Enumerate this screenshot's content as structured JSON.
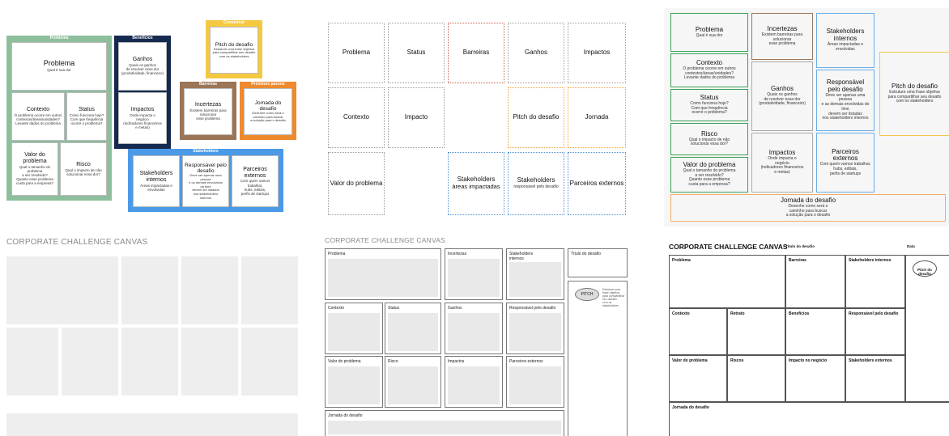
{
  "colors": {
    "green": "#8dbf9c",
    "navy": "#162a4f",
    "yellow": "#f5c842",
    "brown": "#9b7556",
    "orange": "#ee8a2d",
    "blue": "#4a9ae8",
    "p3_green": "#3aa056",
    "p3_blue": "#6aaee6",
    "p3_orange": "#f2ac6a",
    "p3_yellow": "#f2c84b",
    "dot_red": "#c45b4a",
    "dot_orange": "#f0a240",
    "dot_blue": "#4f8fd0"
  },
  "panel1": {
    "groups": {
      "problema": "Problema",
      "beneficios": "Benefícios",
      "comunicar": "Comunicar",
      "barreiras": "Barreiras",
      "proximos": "Próximos passos",
      "stakeholders": "Stakeholders"
    },
    "problema": {
      "t": "Problema",
      "s": "Qual é sua dor"
    },
    "contexto": {
      "t": "Contexto",
      "s": "O problema ocorre em outros\ncontextos/áreas/unidades?\nLevante dados do problema"
    },
    "status": {
      "t": "Status",
      "s": "Como funciona hoje?\nCom que frequência\nocorre o problema?"
    },
    "valor": {
      "t": "Valor do problema",
      "s": "Qual o tamanho do problema\na ser resolvido?\nQuanto esse problema\ncusta para a empresa?"
    },
    "risco": {
      "t": "Risco",
      "s": "Qual o impacto de não\nsolucionar essa dor?"
    },
    "ganhos": {
      "t": "Ganhos",
      "s": "Quais os ganhos\nde resolver essa dor\n(produtividade, financeiro)"
    },
    "impactos": {
      "t": "Impactos",
      "s": "Onde impacta o\nnegócio\n(indicadores financeiros\ne metas)"
    },
    "pitch": {
      "t": "Pitch do desafio",
      "s": "Estruture uma frase objetiva\npara compartilhar seu desafio\ncom os stakeholders"
    },
    "incertezas": {
      "t": "Incertezas",
      "s": "Existem barreiras para\nsolucionar\nesse problema"
    },
    "jornada": {
      "t": "Jornada do desafio",
      "s": "Desenhe como será o\ncaminho para buscar\na solução para o desafio"
    },
    "stake_int": {
      "t": "Stakeholders internos",
      "s": "Áreas impactadas e\nenvolvidas"
    },
    "responsavel": {
      "t": "Responsável pelo desafio",
      "s": "Deve ser apenas uma\npessoa\ne os demais envolvidos\nda time\ndevem ser listados\nnos stakeholders\ninternos"
    },
    "parceiros": {
      "t": "Parceiros externos",
      "s": "Com quem vamos\ntrabalhar,\nhubs, editais,\nperfis de startups"
    }
  },
  "panel2": {
    "problema": "Problema",
    "status": "Status",
    "barreiras": "Barreiras",
    "ganhos": "Ganhos",
    "impactos": "Impactos",
    "contexto": "Contexto",
    "impacto": "Impacto",
    "pitch": "Pitch do desafio",
    "jornada": "Jornada",
    "valor": "Valor do problema",
    "stake_areas_t": "Stakeholders",
    "stake_areas_s": "áreas impactadas",
    "stake_resp_t": "Stakeholders",
    "stake_resp_s": "responsável pelo desafio",
    "parceiros": "Parceiros externos"
  },
  "panel3": {
    "problema": {
      "t": "Problema",
      "s": "Qual é sua dor"
    },
    "contexto": {
      "t": "Contexto",
      "s": "O problema ocorre em outros\ncontextos/áreas/unidades?\nLevante dados do problema"
    },
    "status": {
      "t": "Status",
      "s": "Como funciona hoje?\nCom que frequência\nocorre o problema?"
    },
    "risco": {
      "t": "Risco",
      "s": "Qual o impacto de não\nsolucionar essa dor?"
    },
    "valor": {
      "t": "Valor do problema",
      "s": "Qual o tamanho do problema\na ser resolvido?\nQuanto esse problema\ncusta para a empresa?"
    },
    "incertezas": {
      "t": "Incertezas",
      "s": "Existem barreiras para\nsolucionar\nesse problema"
    },
    "ganhos": {
      "t": "Ganhos",
      "s": "Quais os ganhos\nde resolver essa dor\n(produtividade, financeiro)"
    },
    "impactos": {
      "t": "Impactos",
      "s": "Onde impacta o\nnegócio\n(indicadores financeiros\ne metas)"
    },
    "stake_int": {
      "t": "Stakeholders\ninternos",
      "s": "Áreas impactadas e envolvidas"
    },
    "responsavel": {
      "t": "Responsável\npelo desafio",
      "s": "Deve ser apenas uma pessoa\ne as demais envolvidas do time\ndevem ser listadas\nnos stakeholders internos"
    },
    "parceiros": {
      "t": "Parceiros externos",
      "s": "Com quem vamos trabalhar,\nhubs, editais,\nperfis de startups"
    },
    "pitch": {
      "t": "Pitch do desafio",
      "s": "Estruture uma frase objetiva\npara compartilhar seu desafio\ncom os stakeholders"
    },
    "jornada": {
      "t": "Jornada do desafio",
      "s": "Desenhe como será o\ncaminho para buscar\na solução para o desafio"
    }
  },
  "panel4": {
    "title": "CORPORATE CHALLENGE CANVAS"
  },
  "panel5": {
    "title": "CORPORATE CHALLENGE CANVAS",
    "problema": "Problema",
    "incertezas": "Incertezas",
    "stake_int": "Stakeholders\ninternos",
    "titulo": "Título do desafio",
    "contexto": "Contexto",
    "status": "Status",
    "ganhos": "Ganhos",
    "responsavel": "Responsável pelo desafio",
    "pitch": "PITCH",
    "pitch_note": "Estruture uma\nfrase objetiva\npara compartilhar\nseu desafio\ncom os\nstakeholders",
    "valor": "Valor do problema",
    "risco": "Risco",
    "impactos": "Impactos",
    "parceiros": "Parceiros externos",
    "jornada": "Jornada do desafio"
  },
  "panel6": {
    "title": "CORPORATE CHALLENGE CANVAS",
    "titulo": "Título do desafio",
    "data": "Data",
    "problema": "Problema",
    "barreiras": "Barreiras",
    "stake_int": "Stakeholders internos",
    "contexto": "Contexto",
    "retrato": "Retrato",
    "beneficios": "Benefícios",
    "responsavel": "Responsável pelo desafio",
    "valor": "Valor do problema",
    "riscos": "Riscos",
    "impacto": "Impacto no negócio",
    "stake_ext": "Stakeholders externos",
    "pitch": "Pitch do\ndesafio",
    "jornada": "Jornada do desafio"
  }
}
